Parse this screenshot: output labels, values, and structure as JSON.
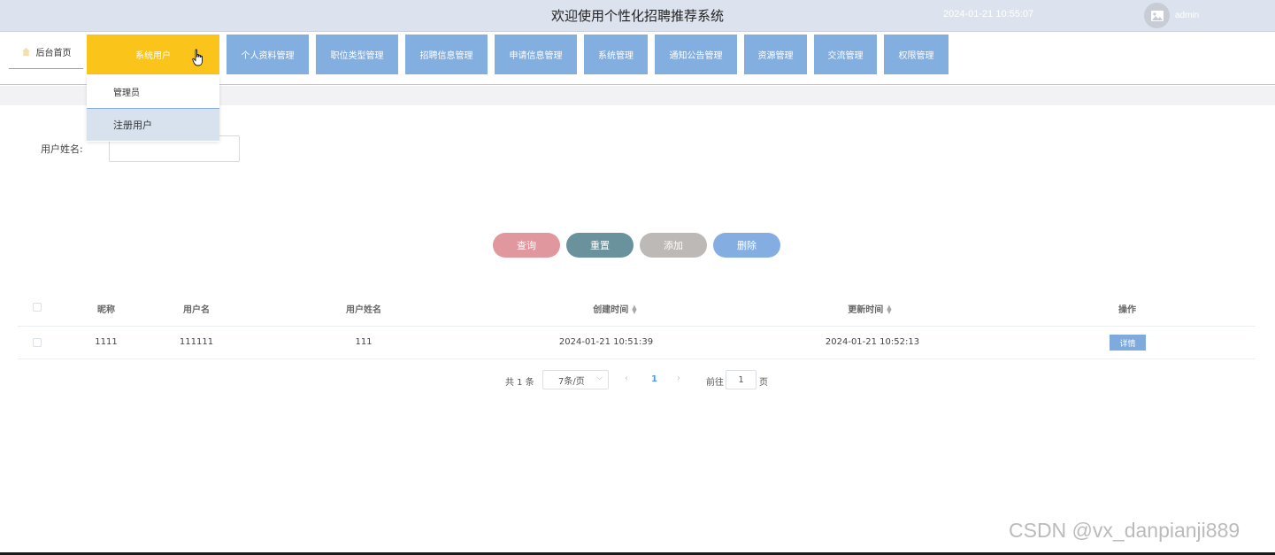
{
  "header": {
    "title": "欢迎使用个性化招聘推荐系统",
    "datetime": "2024-01-21 10:55:07",
    "user": "admin"
  },
  "nav": {
    "home": "后台首页",
    "items": [
      {
        "label": "系统用户"
      },
      {
        "label": "个人资料管理"
      },
      {
        "label": "职位类型管理"
      },
      {
        "label": "招聘信息管理"
      },
      {
        "label": "申请信息管理"
      },
      {
        "label": "系统管理"
      },
      {
        "label": "通知公告管理"
      },
      {
        "label": "资源管理"
      },
      {
        "label": "交流管理"
      },
      {
        "label": "权限管理"
      }
    ],
    "dropdown": [
      "管理员",
      "注册用户"
    ]
  },
  "search": {
    "label": "用户姓名:",
    "value": ""
  },
  "buttons": {
    "query": "查询",
    "reset": "重置",
    "add": "添加",
    "delete": "删除"
  },
  "table": {
    "headers": [
      "昵称",
      "用户名",
      "用户姓名",
      "创建时间",
      "更新时间",
      "操作"
    ],
    "rows": [
      {
        "nickname": "1111",
        "username": "111111",
        "realname": "111",
        "created": "2024-01-21 10:51:39",
        "updated": "2024-01-21 10:52:13",
        "action": "详情"
      }
    ]
  },
  "pagination": {
    "total": "共 1 条",
    "page_size": "7条/页",
    "current": "1",
    "goto_label": "前往",
    "goto_value": "1",
    "page_unit": "页"
  },
  "watermark": "CSDN @vx_danpianji889",
  "colors": {
    "nav_active": "#fbc41a",
    "nav_item": "#83aee0",
    "query_btn": "#e0979d",
    "reset_btn": "#6a929c",
    "add_btn": "#bdb9b6",
    "delete_btn": "#84ade2"
  }
}
